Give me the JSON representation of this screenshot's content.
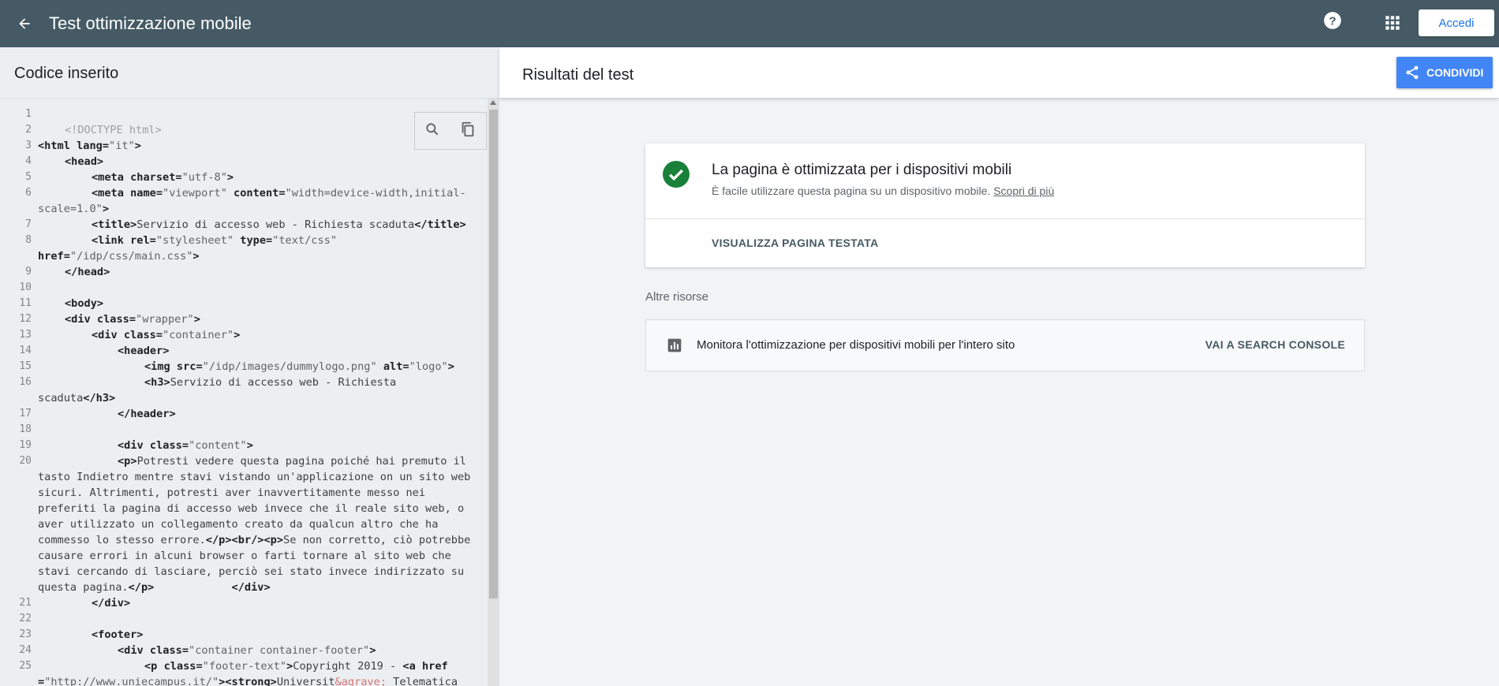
{
  "header": {
    "title": "Test ottimizzazione mobile",
    "signin_label": "Accedi"
  },
  "left_panel": {
    "title": "Codice inserito",
    "line_numbers": [
      "1",
      "2",
      "3",
      "4",
      "5",
      "6",
      "7",
      "8",
      "9",
      "10",
      "11",
      "12",
      "13",
      "14",
      "15",
      "16",
      "17",
      "18",
      "19",
      "20",
      "21",
      "22",
      "23",
      "24",
      "25"
    ],
    "code": {
      "l2": "<!DOCTYPE html>",
      "l3a": "<html ",
      "l3b": "lang=",
      "l3c": "\"it\"",
      "l3d": ">",
      "l4": "<head>",
      "l5a": "<meta ",
      "l5b": "charset=",
      "l5c": "\"utf-8\"",
      "l5d": ">",
      "l6a": "<meta ",
      "l6b": "name=",
      "l6c": "\"viewport\"",
      "l6d": " content=",
      "l6e": "\"width=device-width,initial-",
      "l6f": "scale=1.0\"",
      "l6g": ">",
      "l7a": "<title>",
      "l7b": "Servizio di accesso web - Richiesta scaduta",
      "l7c": "</title>",
      "l8a": "<link ",
      "l8b": "rel=",
      "l8c": "\"stylesheet\"",
      "l8d": " type=",
      "l8e": "\"text/css\"",
      "l8f": "href=",
      "l8g": "\"/idp/css/main.css\"",
      "l8h": ">",
      "l9": "</head>",
      "l11": "<body>",
      "l12a": "<div ",
      "l12b": "class=",
      "l12c": "\"wrapper\"",
      "l12d": ">",
      "l13a": "<div ",
      "l13b": "class=",
      "l13c": "\"container\"",
      "l13d": ">",
      "l14": "<header>",
      "l15a": "<img ",
      "l15b": "src=",
      "l15c": "\"/idp/images/dummylogo.png\"",
      "l15d": " alt=",
      "l15e": "\"logo\"",
      "l15f": ">",
      "l16a": "<h3>",
      "l16b": "Servizio di accesso web - Richiesta",
      "l16c": "scaduta",
      "l16d": "</h3>",
      "l17": "</header>",
      "l19a": "<div ",
      "l19b": "class=",
      "l19c": "\"content\"",
      "l19d": ">",
      "l20a": "<p>",
      "l20b": "Potresti vedere questa pagina poiché hai premuto il",
      "l20c": "tasto Indietro mentre stavi vistando un'applicazione on un sito web",
      "l20d": "sicuri. Altrimenti, potresti aver inavvertitamente messo nei",
      "l20e": "preferiti la pagina di accesso web invece che il reale sito web, o",
      "l20f": "aver utilizzato un collegamento creato da qualcun altro che ha",
      "l20g": "commesso lo stesso errore.",
      "l20h": "</p><br/><p>",
      "l20i": "Se non corretto, ciò potrebbe",
      "l20j": "causare errori in alcuni browser o farti tornare al sito web che",
      "l20k": "stavi cercando di lasciare, perciò sei stato invece indirizzato su",
      "l20l": "questa pagina.",
      "l20m": "</p>",
      "l20n": "            ",
      "l20o": "</div>",
      "l21": "</div>",
      "l23": "<footer>",
      "l24a": "<div ",
      "l24b": "class=",
      "l24c": "\"container container-footer\"",
      "l24d": ">",
      "l25a": "<p ",
      "l25b": "class=",
      "l25c": "\"footer-text\"",
      "l25d": ">",
      "l25e": "Copyright 2019 - ",
      "l25f": "<a ",
      "l25g": "href",
      "l25h": "=",
      "l25i": "\"http://www.uniecampus.it/\"",
      "l25j": "><strong>",
      "l25k": "Universit",
      "l25l": "&agrave;",
      "l25m": " Telematica"
    }
  },
  "right_panel": {
    "title": "Risultati del test",
    "share_label": "CONDIVIDI",
    "result": {
      "title": "La pagina è ottimizzata per i dispositivi mobili",
      "subtitle": "È facile utilizzare questa pagina su un dispositivo mobile.",
      "link": "Scopri di più",
      "action": "VISUALIZZA PAGINA TESTATA"
    },
    "resources": {
      "label": "Altre risorse",
      "text": "Monitora l'ottimizzazione per dispositivi mobili per l'intero sito",
      "action": "VAI A SEARCH CONSOLE"
    }
  },
  "colors": {
    "topbar": "#455a64",
    "accent": "#4285f4",
    "success": "#188038"
  }
}
